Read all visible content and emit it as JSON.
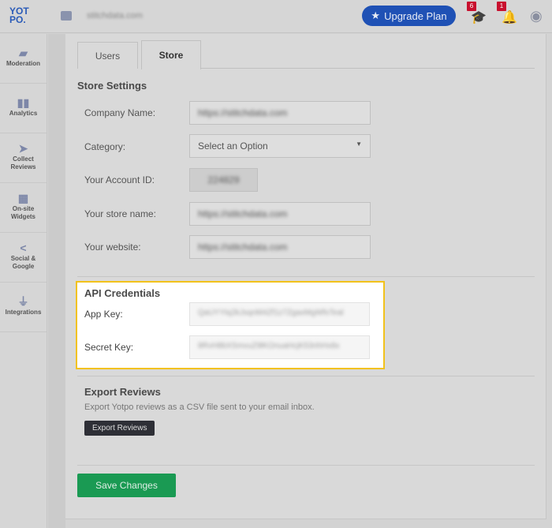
{
  "header": {
    "logo": "YOT PO.",
    "store_name": "stitchdata.com",
    "upgrade_label": "Upgrade Plan",
    "learning_badge": "6",
    "notifications_badge": "1"
  },
  "sidebar": {
    "items": [
      {
        "label": "Moderation",
        "icon": "folder-icon"
      },
      {
        "label": "Analytics",
        "icon": "bar-chart-icon"
      },
      {
        "label": "Collect Reviews",
        "icon": "send-icon"
      },
      {
        "label": "On-site Widgets",
        "icon": "widgets-icon"
      },
      {
        "label": "Social & Google",
        "icon": "share-icon"
      },
      {
        "label": "Integrations",
        "icon": "plug-icon"
      }
    ]
  },
  "tabs": [
    {
      "label": "Users"
    },
    {
      "label": "Store",
      "active": true
    }
  ],
  "store_settings": {
    "title": "Store Settings",
    "company_name_label": "Company Name:",
    "company_name": "https://stitchdata.com",
    "category_label": "Category:",
    "category_placeholder": "Select an Option",
    "account_id_label": "Your Account ID:",
    "account_id": "224829",
    "store_name_label": "Your store name:",
    "store_name": "https://stitchdata.com",
    "website_label": "Your website:",
    "website": "https://stitchdata.com"
  },
  "api": {
    "title": "API Credentials",
    "app_key_label": "App Key:",
    "app_key": "QaUYYtq2kJsqnM4Zf1z7ZgaxMgWfsTeal",
    "secret_key_label": "Secret Key:",
    "secret_key": "8RvH8bXSmvuZ9lKOnuaHcjK53nhHx8x"
  },
  "export": {
    "title": "Export Reviews",
    "description": "Export Yotpo reviews as a CSV file sent to your email inbox.",
    "button": "Export Reviews"
  },
  "save_label": "Save Changes",
  "colors": {
    "accent": "#1f51b5",
    "highlight": "#f2c21b",
    "save": "#1a9a53"
  }
}
